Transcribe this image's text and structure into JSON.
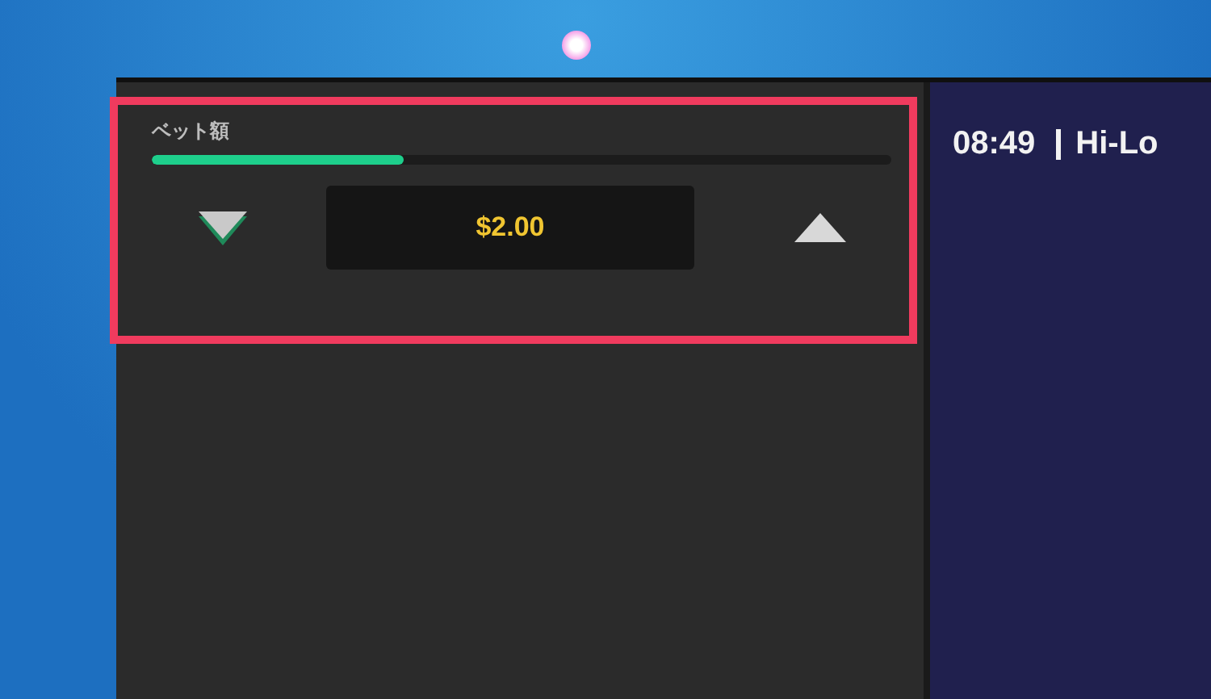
{
  "bet_panel": {
    "label": "ベット額",
    "level": 0.34,
    "amount": "$2.00",
    "highlighted": true
  },
  "header": {
    "time": "08:49",
    "title": "Hi-Lo"
  }
}
